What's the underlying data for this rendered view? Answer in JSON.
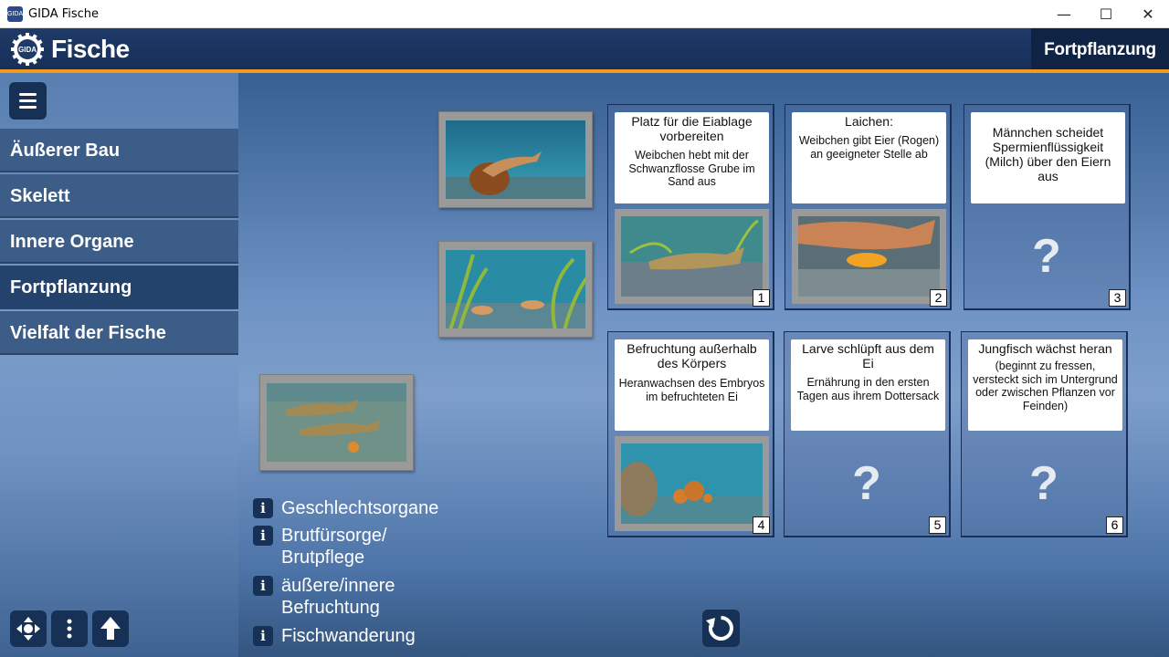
{
  "window": {
    "title": "GIDA Fische",
    "icon": "gida-app-icon"
  },
  "header": {
    "app_title": "Fische",
    "logo": "gida-gear-logo",
    "section_title": "Fortpflanzung"
  },
  "sidebar": {
    "menu_icon": "hamburger-icon",
    "items": [
      {
        "label": "Äußerer Bau",
        "active": false
      },
      {
        "label": "Skelett",
        "active": false
      },
      {
        "label": "Innere Organe",
        "active": false
      },
      {
        "label": "Fortpflanzung",
        "active": true
      },
      {
        "label": "Vielfalt der Fische",
        "active": false
      }
    ],
    "bottom_buttons": [
      "navigation-cross-icon",
      "more-vertical-icon",
      "arrow-up-icon"
    ]
  },
  "images": [
    {
      "name": "image-male-spawning",
      "scene": "fish-fin-over-rock"
    },
    {
      "name": "image-young-fish-plants",
      "scene": "small-fish-among-plants"
    },
    {
      "name": "image-larvae-hatching",
      "scene": "two-fish-over-gravel"
    }
  ],
  "slots": [
    {
      "number": "1",
      "title": "Platz für die Eiablage vorbereiten",
      "desc": "Weibchen hebt mit der Schwanzflosse Grube im Sand aus",
      "placed": true,
      "scene": "trout-over-gravel"
    },
    {
      "number": "2",
      "title": "Laichen:",
      "desc": "Weibchen gibt Eier (Rogen) an geeigneter Stelle ab",
      "placed": true,
      "scene": "fish-laying-eggs"
    },
    {
      "number": "3",
      "title": "Männchen scheidet Spermienflüssigkeit (Milch) über den Eiern aus",
      "desc": "",
      "placed": false,
      "placeholder": "?"
    },
    {
      "number": "4",
      "title": "Befruchtung außerhalb des Körpers",
      "desc": "Heranwachsen des Embryos im befruchteten Ei",
      "placed": true,
      "scene": "fertilized-eggs"
    },
    {
      "number": "5",
      "title": "Larve schlüpft aus dem Ei",
      "desc": "Ernährung in den ersten Tagen aus ihrem Dottersack",
      "placed": false,
      "placeholder": "?"
    },
    {
      "number": "6",
      "title": "Jungfisch wächst heran",
      "desc": "(beginnt zu fressen, versteckt sich im Untergrund oder zwischen Pflanzen vor Feinden)",
      "placed": false,
      "placeholder": "?"
    }
  ],
  "info_links": [
    {
      "label": "Geschlechtsorgane",
      "icon": "info-icon"
    },
    {
      "label": "Brutfürsorge/\nBrutpflege",
      "icon": "info-icon"
    },
    {
      "label": "äußere/innere\nBefruchtung",
      "icon": "info-icon"
    },
    {
      "label": "Fischwanderung",
      "icon": "info-icon"
    }
  ],
  "reset_icon": "reset-icon",
  "colors": {
    "header": "#1e3a66",
    "accent": "#f29a1c",
    "button": "#173156",
    "nav_item": "#3d5d89",
    "nav_active": "#23426c"
  }
}
